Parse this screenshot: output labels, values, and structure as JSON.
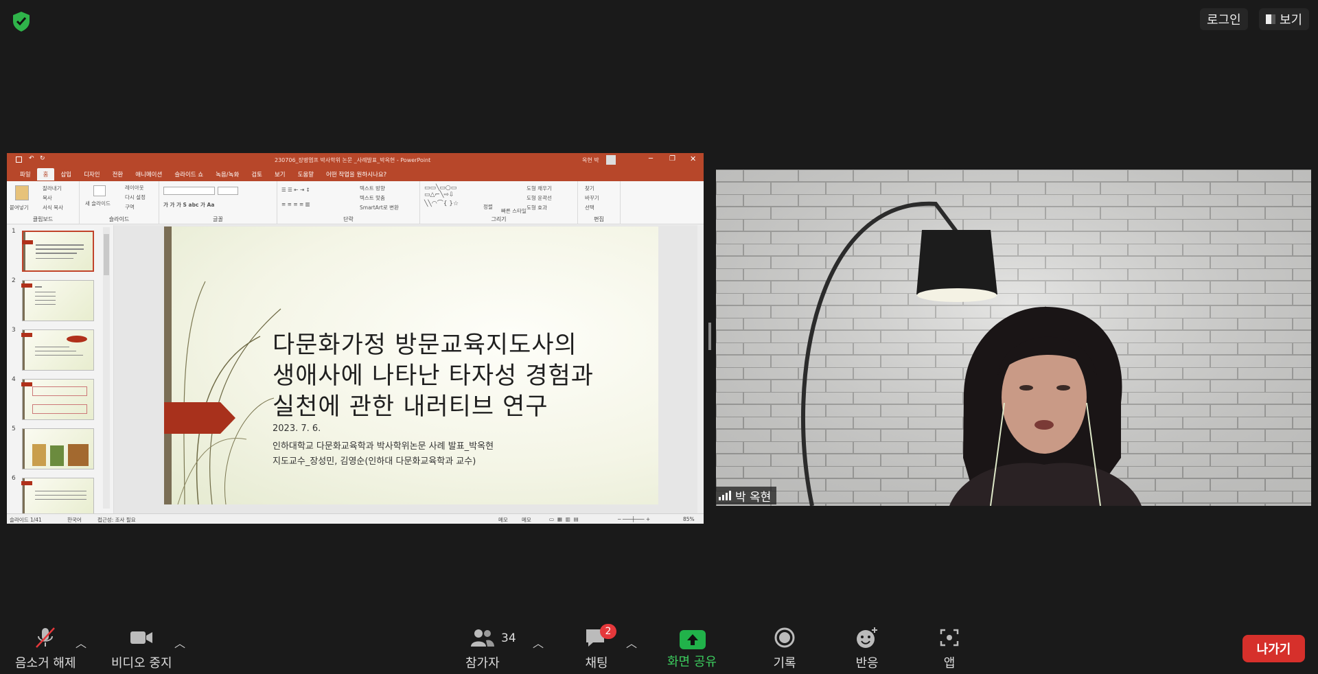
{
  "top_bar": {
    "login_label": "로그인",
    "view_label": "보기"
  },
  "ppt": {
    "window_title": "230706_장병엽프 박사학위 논문 _사례발표_박옥현 - PowerPoint",
    "user_name": "옥현 박",
    "tabs": [
      "파일",
      "홈",
      "삽입",
      "디자인",
      "전환",
      "애니메이션",
      "슬라이드 쇼",
      "녹음/녹화",
      "검토",
      "보기",
      "도움말",
      "어떤 작업을 원하시나요?"
    ],
    "active_tab": "홈",
    "groups": {
      "clipboard": "클립보드",
      "slides": "슬라이드",
      "font": "글꼴",
      "paragraph": "단락",
      "drawing": "그리기",
      "editing": "편집"
    },
    "ribbon_items": {
      "paste": "붙여넣기",
      "cut": "잘라내기",
      "copy": "복사",
      "format_painter": "서식 복사",
      "new_slide": "새 슬라이드",
      "layout": "레이아웃",
      "reset": "다시 설정",
      "section": "구역",
      "text_direction": "텍스트 방향",
      "align_text": "텍스트 맞춤",
      "smartart": "SmartArt로 변환",
      "arrange": "정렬",
      "quick_styles": "빠른 스타일",
      "shape_fill": "도형 채우기",
      "shape_outline": "도형 윤곽선",
      "shape_effects": "도형 효과",
      "find": "찾기",
      "replace": "바꾸기",
      "select": "선택"
    },
    "thumbnails": [
      "1",
      "2",
      "3",
      "4",
      "5",
      "6"
    ],
    "slide": {
      "title_line1": "다문화가정 방문교육지도사의",
      "title_line2": "생애사에 나타난 타자성 경험과",
      "title_line3": "실천에 관한 내러티브 연구",
      "date": "2023. 7. 6.",
      "line2": "인하대학교 다문화교육학과 박사학위논문 사례 발표_박옥현",
      "line3": "지도교수_장성민, 김영순(인하대 다문화교육학과 교수)"
    },
    "status": {
      "slide_info": "슬라이드 1/41",
      "language": "한국어",
      "accessibility": "접근성: 조사 필요",
      "notes": "메모",
      "comments": "메모",
      "zoom": "85%"
    }
  },
  "video": {
    "participant_name": "박 옥현"
  },
  "toolbar": {
    "mute_label": "음소거 해제",
    "video_label": "비디오 중지",
    "participants_label": "참가자",
    "participants_count": "34",
    "chat_label": "채팅",
    "chat_badge": "2",
    "share_label": "화면 공유",
    "record_label": "기록",
    "reactions_label": "반응",
    "apps_label": "앱",
    "leave_label": "나가기"
  },
  "colors": {
    "ppt_accent": "#b7472a",
    "share_green": "#21b24a",
    "leave_red": "#d6302b",
    "shield_green": "#2fb34a"
  }
}
